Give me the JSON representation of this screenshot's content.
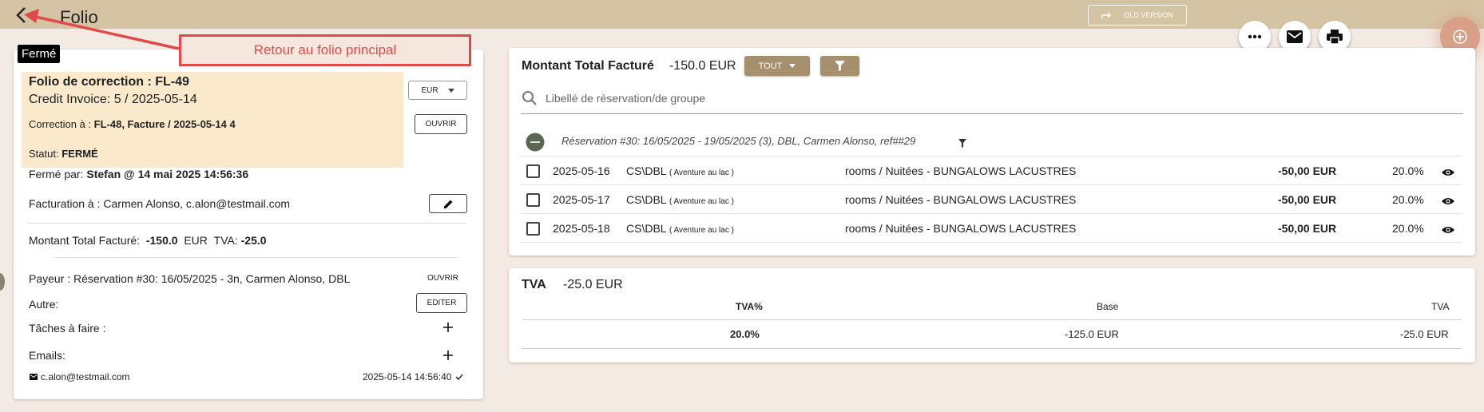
{
  "header": {
    "title": "Folio",
    "old_version_label": "OLD VERSION"
  },
  "callout": {
    "text": "Retour au folio principal"
  },
  "left": {
    "status_badge": "Fermé",
    "folio_title": "Folio de correction : FL-49",
    "credit_invoice": "Credit Invoice: 5 / 2025-05-14",
    "correction_label": "Correction à : ",
    "correction_value": "FL-48, Facture / 2025-05-14 4",
    "statut_label": "Statut: ",
    "statut_value": "FERMÉ",
    "ferme_par_label": "Fermé par: ",
    "ferme_par_value": "Stefan @ 14 mai 2025 14:56:36",
    "currency_select": "EUR",
    "ouvrir_btn": "OUVRIR",
    "facturation_label": "Facturation à : ",
    "facturation_value": "Carmen Alonso, c.alon@testmail.com",
    "montant_label": "Montant Total Facturé:",
    "montant_value": "-150.0",
    "montant_currency": "EUR",
    "tva_label": "TVA:",
    "tva_value": "-25.0",
    "payeur_label": "Payeur : ",
    "payeur_value": "Réservation #30: 16/05/2025 - 3n, Carmen Alonso, DBL",
    "payeur_btn": "OUVRIR",
    "autre_label": "Autre:",
    "editer_btn": "EDITER",
    "taches_label": "Tâches à faire :",
    "emails_label": "Emails:",
    "email_addr": "c.alon@testmail.com",
    "email_date": "2025-05-14 14:56:40"
  },
  "main": {
    "total_label": "Montant Total Facturé",
    "total_value": "-150.0 EUR",
    "tout_btn": "TOUT",
    "search_placeholder": "Libellé de réservation/de groupe",
    "group_label": "Réservation #30: 16/05/2025 - 19/05/2025 (3), DBL, Carmen Alonso, ref##29",
    "rows": [
      {
        "date": "2025-05-16",
        "room": "CS\\DBL",
        "room_note": "( Aventure au lac )",
        "desc": "rooms / Nuitées - BUNGALOWS LACUSTRES",
        "amount": "-50,00 EUR",
        "rate": "20.0%"
      },
      {
        "date": "2025-05-17",
        "room": "CS\\DBL",
        "room_note": "( Aventure au lac )",
        "desc": "rooms / Nuitées - BUNGALOWS LACUSTRES",
        "amount": "-50,00 EUR",
        "rate": "20.0%"
      },
      {
        "date": "2025-05-18",
        "room": "CS\\DBL",
        "room_note": "( Aventure au lac )",
        "desc": "rooms / Nuitées - BUNGALOWS LACUSTRES",
        "amount": "-50,00 EUR",
        "rate": "20.0%"
      }
    ]
  },
  "tva": {
    "title": "TVA",
    "total": "-25.0 EUR",
    "col_rate": "TVA%",
    "col_base": "Base",
    "col_tva": "TVA",
    "rate": "20.0%",
    "base": "-125.0 EUR",
    "amount": "-25.0 EUR"
  },
  "colors": {
    "topbar": "#d4c4a4",
    "background": "#f3ebe3",
    "highlight": "#faeacb",
    "brown_button": "#a68f6d",
    "fab_add": "#d9a088",
    "callout_red": "#e24a4a"
  },
  "icons": [
    "back-arrow-icon",
    "share-icon",
    "more-icon",
    "mail-icon",
    "print-icon",
    "add-icon",
    "dropdown-caret-icon",
    "pencil-icon",
    "plus-icon",
    "email-icon",
    "check-icon",
    "filter-icon",
    "search-icon",
    "collapse-icon",
    "eye-icon"
  ]
}
